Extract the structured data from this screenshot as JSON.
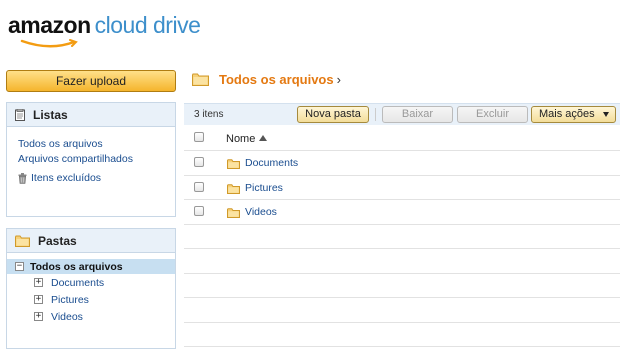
{
  "logo": {
    "amazon": "amazon",
    "cloud_drive": "cloud drive"
  },
  "upload_button": "Fazer upload",
  "listas": {
    "title": "Listas",
    "links": [
      "Todos os arquivos",
      "Arquivos compartilhados"
    ],
    "trash": "Itens excluídos"
  },
  "pastas": {
    "title": "Pastas",
    "root": "Todos os arquivos",
    "root_toggle": "−",
    "node_toggle": "+",
    "nodes": [
      "Documents",
      "Pictures",
      "Videos"
    ]
  },
  "breadcrumb": {
    "current": "Todos os arquivos",
    "separator": "›"
  },
  "toolbar": {
    "count": "3 itens",
    "new_folder": "Nova pasta",
    "download": "Baixar",
    "delete": "Excluir",
    "more": "Mais ações"
  },
  "table": {
    "column_name": "Nome",
    "rows": [
      "Documents",
      "Pictures",
      "Videos"
    ]
  },
  "colors": {
    "accent_orange": "#e47911",
    "link_blue": "#1a4d8f",
    "panel_header": "#e9f1f9",
    "upload_yellow": "#f5b52d"
  }
}
